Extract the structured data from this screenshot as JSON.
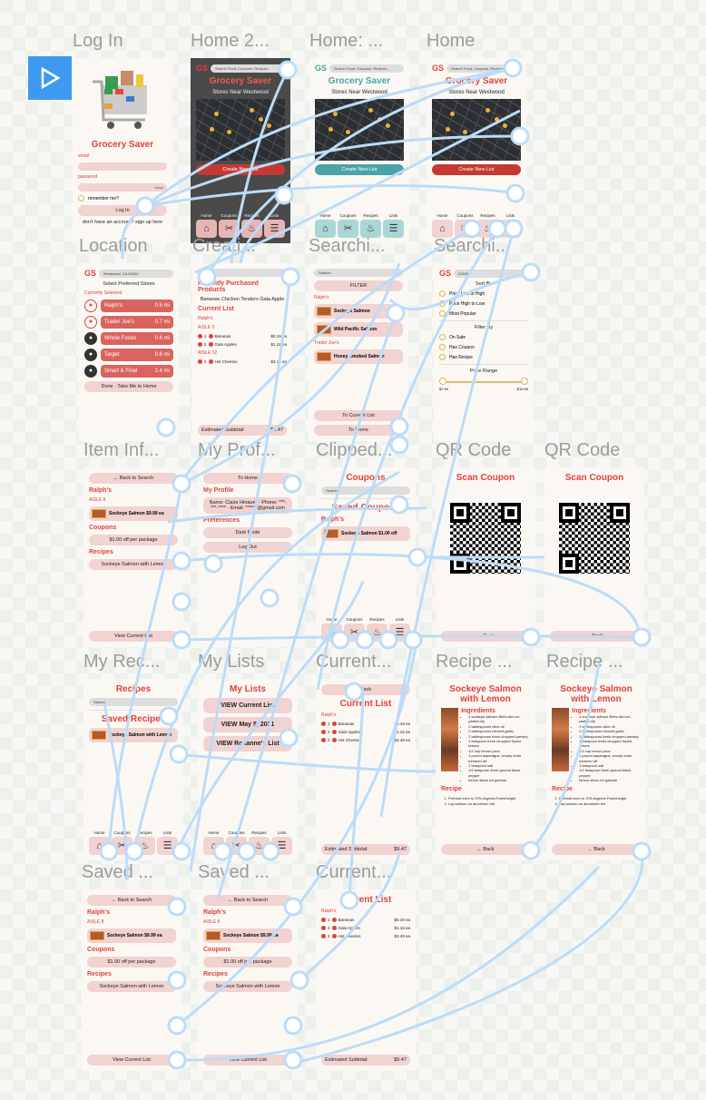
{
  "play_label": "Present",
  "frames": [
    {
      "id": "login",
      "title": "Log In",
      "blocks": [
        {
          "k": "cart"
        },
        {
          "k": "title",
          "t": "Grocery Saver"
        },
        {
          "k": "small",
          "t": "email"
        },
        {
          "k": "field",
          "t": ""
        },
        {
          "k": "small",
          "t": "password"
        },
        {
          "k": "field",
          "t": "show"
        },
        {
          "k": "radio",
          "t": "remember me?"
        },
        {
          "k": "pill",
          "t": "Log In"
        },
        {
          "k": "text",
          "t": "don't have an account? sign up here"
        }
      ]
    },
    {
      "id": "home2",
      "title": "Home 2...",
      "dark": true,
      "blocks": [
        {
          "k": "head",
          "t": "GS",
          "s": "Search Food, Coupons, Recipes..."
        },
        {
          "k": "title",
          "t": "Grocery Saver"
        },
        {
          "k": "sub",
          "t": "Stores Near Westwood"
        },
        {
          "k": "map"
        },
        {
          "k": "pill",
          "t": "Create New List",
          "v": "red"
        },
        {
          "k": "nav",
          "items": [
            "Home",
            "Coupons",
            "Recipes",
            "Lists"
          ]
        }
      ]
    },
    {
      "id": "home3",
      "title": "Home: ...",
      "blocks": [
        {
          "k": "head",
          "t": "GS",
          "s": "Search Food, Coupons, Recipes...",
          "v": "teal"
        },
        {
          "k": "title",
          "t": "Grocery Saver",
          "v": "teal"
        },
        {
          "k": "sub",
          "t": "Stores Near Westwood"
        },
        {
          "k": "map"
        },
        {
          "k": "pill",
          "t": "Create New List",
          "v": "teal"
        },
        {
          "k": "nav",
          "items": [
            "Home",
            "Coupons",
            "Recipes",
            "Lists"
          ],
          "v": "teal"
        }
      ]
    },
    {
      "id": "home",
      "title": "Home",
      "blocks": [
        {
          "k": "head",
          "t": "GS",
          "s": "Search Food, Coupons, Recipes..."
        },
        {
          "k": "title",
          "t": "Grocery Saver"
        },
        {
          "k": "sub",
          "t": "Stores Near Westwood"
        },
        {
          "k": "map"
        },
        {
          "k": "pill",
          "t": "Create New List",
          "v": "red"
        },
        {
          "k": "nav",
          "items": [
            "Home",
            "Coupons",
            "Recipes",
            "Lists"
          ],
          "v": "light"
        }
      ]
    },
    {
      "id": "location",
      "title": "Location",
      "blocks": [
        {
          "k": "head",
          "t": "GS",
          "s": "Westwood, CA 90024"
        },
        {
          "k": "text",
          "t": "Select Preferred Stores"
        },
        {
          "k": "small",
          "t": "Currently Selected"
        },
        {
          "k": "store",
          "t": "Ralph's",
          "d": "0.6 mi"
        },
        {
          "k": "store",
          "t": "Trader Joe's",
          "d": "0.7 mi"
        },
        {
          "k": "store",
          "t": "Whole Foods",
          "d": "0.6 mi",
          "blk": true
        },
        {
          "k": "store",
          "t": "Target",
          "d": "0.6 mi",
          "blk": true
        },
        {
          "k": "store",
          "t": "Smart & Final",
          "d": "2.4 mi",
          "blk": true
        },
        {
          "k": "pill",
          "t": "Done · Take Me to Home"
        }
      ]
    },
    {
      "id": "create",
      "title": "Creati...",
      "blocks": [
        {
          "k": "search",
          "t": "Search"
        },
        {
          "k": "label",
          "t": "Recently Purchased Products"
        },
        {
          "k": "text",
          "t": "Bananas   Chicken Tenders   Gala Apple"
        },
        {
          "k": "label",
          "t": "Current List"
        },
        {
          "k": "small",
          "t": "Ralph's"
        },
        {
          "k": "small",
          "t": "AISLE 5"
        },
        {
          "k": "row",
          "q": "1",
          "n": "Bananas",
          "p": "$0.19 ea"
        },
        {
          "k": "row",
          "q": "2",
          "n": "Gala Apples",
          "p": "$1.15 ea"
        },
        {
          "k": "small",
          "t": "AISLE 12"
        },
        {
          "k": "row",
          "q": "2",
          "n": "Hot Cheetos",
          "p": "$3.49 ea"
        },
        {
          "k": "subtotal",
          "t": "Estimated Subtotal:",
          "p": "$9.47"
        }
      ]
    },
    {
      "id": "search1",
      "title": "Searchi...",
      "blocks": [
        {
          "k": "search",
          "t": "Salmon"
        },
        {
          "k": "pill",
          "t": "FILTER"
        },
        {
          "k": "small",
          "t": "Ralph's"
        },
        {
          "k": "item",
          "t": "Sockeye Salmon"
        },
        {
          "k": "item",
          "t": "Wild Pacific Salmon"
        },
        {
          "k": "small",
          "t": "Trader Joe's"
        },
        {
          "k": "item",
          "t": "Honey Smoked Salmon"
        },
        {
          "k": "pill",
          "t": "To Current List",
          "back": true
        },
        {
          "k": "pill",
          "t": "To Home"
        }
      ]
    },
    {
      "id": "search2",
      "title": "Searchi...",
      "blocks": [
        {
          "k": "head",
          "t": "GS",
          "s": "DONE"
        },
        {
          "k": "text",
          "t": "Sort By"
        },
        {
          "k": "radio",
          "t": "Price Low to High"
        },
        {
          "k": "radio",
          "t": "Price High to Low"
        },
        {
          "k": "radio",
          "t": "Most Popular"
        },
        {
          "k": "hr"
        },
        {
          "k": "text",
          "t": "Filter By"
        },
        {
          "k": "radio",
          "t": "On Sale"
        },
        {
          "k": "radio",
          "t": "Has Coupon"
        },
        {
          "k": "radio",
          "t": "Has Recipe"
        },
        {
          "k": "hr"
        },
        {
          "k": "text",
          "t": "Price Range"
        },
        {
          "k": "slider",
          "min": "$7.50",
          "max": "$19.99"
        }
      ]
    },
    {
      "id": "item",
      "title": "Item Inf...",
      "blocks": [
        {
          "k": "pill",
          "t": "← Back to Search"
        },
        {
          "k": "label",
          "t": "Ralph's"
        },
        {
          "k": "small",
          "t": "AISLE 8"
        },
        {
          "k": "item",
          "t": "Sockeye Salmon $9.99 ea"
        },
        {
          "k": "label",
          "t": "Coupons"
        },
        {
          "k": "pill",
          "t": "$1.00 off per package"
        },
        {
          "k": "label",
          "t": "Recipes"
        },
        {
          "k": "pill",
          "t": "Sockeye Salmon with Lemon"
        },
        {
          "k": "pill",
          "t": "View Current List",
          "back": true
        }
      ]
    },
    {
      "id": "profile",
      "title": "My Prof...",
      "blocks": [
        {
          "k": "pill",
          "t": "To Home"
        },
        {
          "k": "label",
          "t": "My Profile"
        },
        {
          "k": "pill",
          "t": "Name: Claire Hinauer · Phone: ***-***-**** · Email: ******@gmail.com"
        },
        {
          "k": "label",
          "t": "Preferences"
        },
        {
          "k": "pill",
          "t": "Dark Mode"
        },
        {
          "k": "pill",
          "t": "Log Out"
        }
      ]
    },
    {
      "id": "clipped",
      "title": "Clipped...",
      "blocks": [
        {
          "k": "title",
          "t": "Coupons"
        },
        {
          "k": "search",
          "t": "Search"
        },
        {
          "k": "hr"
        },
        {
          "k": "title",
          "t": "Saved Coupons"
        },
        {
          "k": "label",
          "t": "Ralph's"
        },
        {
          "k": "item",
          "t": "Sockeye Salmon $1.00 off"
        },
        {
          "k": "nav",
          "items": [
            "Home",
            "Coupons",
            "Recipes",
            "Lists"
          ],
          "v": "light"
        }
      ]
    },
    {
      "id": "qr1",
      "title": "QR Code",
      "blocks": [
        {
          "k": "title",
          "t": "Scan Coupon"
        },
        {
          "k": "qr"
        },
        {
          "k": "pill",
          "t": "← Back",
          "back": true
        }
      ]
    },
    {
      "id": "qr2",
      "title": "QR Code",
      "blocks": [
        {
          "k": "title",
          "t": "Scan Coupon"
        },
        {
          "k": "qr"
        },
        {
          "k": "pill",
          "t": "← Back",
          "back": true
        }
      ]
    },
    {
      "id": "myrecipes",
      "title": "My Rec...",
      "blocks": [
        {
          "k": "title",
          "t": "Recipes"
        },
        {
          "k": "search",
          "t": "Search"
        },
        {
          "k": "hr"
        },
        {
          "k": "title",
          "t": "Saved Recipes"
        },
        {
          "k": "item",
          "t": "Sockeye Salmon with Lemon"
        },
        {
          "k": "nav",
          "items": [
            "Home",
            "Coupons",
            "Recipes",
            "Lists"
          ],
          "v": "light"
        }
      ]
    },
    {
      "id": "mylists",
      "title": "My Lists",
      "blocks": [
        {
          "k": "title",
          "t": "My Lists"
        },
        {
          "k": "pill",
          "t": "VIEW Current List",
          "v": "big"
        },
        {
          "k": "pill",
          "t": "VIEW May 5, 2021",
          "v": "big"
        },
        {
          "k": "pill",
          "t": "VIEW Roxanne's List",
          "v": "big"
        },
        {
          "k": "nav",
          "items": [
            "Home",
            "Coupons",
            "Recipes",
            "Lists"
          ],
          "v": "light"
        }
      ]
    },
    {
      "id": "current",
      "title": "Current...",
      "blocks": [
        {
          "k": "pill",
          "t": "Back"
        },
        {
          "k": "title",
          "t": "Current List"
        },
        {
          "k": "small",
          "t": "Ralph's"
        },
        {
          "k": "row",
          "q": "1",
          "n": "Bananas",
          "p": "$0.19 ea"
        },
        {
          "k": "row",
          "q": "2",
          "n": "Gala Apples",
          "p": "$1.15 ea"
        },
        {
          "k": "row",
          "q": "2",
          "n": "Hot Cheetos",
          "p": "$3.49 ea"
        },
        {
          "k": "subtotal",
          "t": "Estimated Subtotal:",
          "p": "$9.47"
        }
      ]
    },
    {
      "id": "recipe1",
      "title": "Recipe ...",
      "blocks": [
        {
          "k": "title",
          "t": "Sockeye Salmon with Lemon"
        },
        {
          "k": "recipe"
        },
        {
          "k": "label",
          "t": "Recipe"
        },
        {
          "k": "ol",
          "items": [
            "Preheat oven to 375-degrees Farenheight",
            "Lay salmon on aluminum foil"
          ]
        },
        {
          "k": "pill",
          "t": "← Back",
          "back": true
        }
      ]
    },
    {
      "id": "recipe2",
      "title": "Recipe ...",
      "blocks": [
        {
          "k": "title",
          "t": "Sockeye Salmon with Lemon"
        },
        {
          "k": "recipe"
        },
        {
          "k": "label",
          "t": "Recipe"
        },
        {
          "k": "ol",
          "items": [
            "Preheat oven to 375-degrees Farenheight",
            "Lay salmon on aluminum foil"
          ]
        },
        {
          "k": "pill",
          "t": "← Back",
          "back": true
        }
      ]
    },
    {
      "id": "saved1",
      "title": "Saved ...",
      "blocks": [
        {
          "k": "pill",
          "t": "← Back to Search"
        },
        {
          "k": "label",
          "t": "Ralph's"
        },
        {
          "k": "small",
          "t": "AISLE 8"
        },
        {
          "k": "item",
          "t": "Sockeye Salmon $9.99 ea"
        },
        {
          "k": "label",
          "t": "Coupons"
        },
        {
          "k": "pill",
          "t": "$1.00 off per package"
        },
        {
          "k": "label",
          "t": "Recipes"
        },
        {
          "k": "pill",
          "t": "Sockeye Salmon with Lemon"
        },
        {
          "k": "pill",
          "t": "View Current List",
          "back": true
        }
      ]
    },
    {
      "id": "saved2",
      "title": "Saved ...",
      "blocks": [
        {
          "k": "pill",
          "t": "← Back to Search"
        },
        {
          "k": "label",
          "t": "Ralph's"
        },
        {
          "k": "small",
          "t": "AISLE 8"
        },
        {
          "k": "item",
          "t": "Sockeye Salmon $9.99 ea"
        },
        {
          "k": "label",
          "t": "Coupons"
        },
        {
          "k": "pill",
          "t": "$1.00 off per package"
        },
        {
          "k": "label",
          "t": "Recipes"
        },
        {
          "k": "pill",
          "t": "Sockeye Salmon with Lemon"
        },
        {
          "k": "pill",
          "t": "View Current List",
          "back": true
        }
      ]
    },
    {
      "id": "current2",
      "title": "Current...",
      "blocks": [
        {
          "k": "title",
          "t": "Current List"
        },
        {
          "k": "small",
          "t": "Ralph's"
        },
        {
          "k": "row",
          "q": "1",
          "n": "Bananas",
          "p": "$0.19 ea"
        },
        {
          "k": "row",
          "q": "2",
          "n": "Gala Apples",
          "p": "$1.15 ea"
        },
        {
          "k": "row",
          "q": "2",
          "n": "Hot Cheetos",
          "p": "$3.49 ea"
        },
        {
          "k": "subtotal",
          "t": "Estimated Subtotal:",
          "p": "$9.47"
        }
      ]
    }
  ],
  "recipe": {
    "heading": "Ingredients",
    "items": [
      "4 sockeye salmon fillets skin-on, patted dry",
      "2 tablespoons olive oil",
      "2 tablespoons minced garlic",
      "2 tablespoons fresh chopped parsley",
      "1 teaspoon fresh chopped thyme leaves",
      "1/2 cup lemon juice",
      "1 pound asparagus, woody ends trimmed off",
      "1 teaspoon salt",
      "1/2 teaspoon fresh ground black pepper",
      "lemon slices for garnish"
    ]
  },
  "colors": {
    "accent": "#e0403c",
    "pill": "#f1d3d1",
    "teal": "#4aa3a6",
    "link": "#bcdcf8",
    "play": "#3d9af0"
  }
}
